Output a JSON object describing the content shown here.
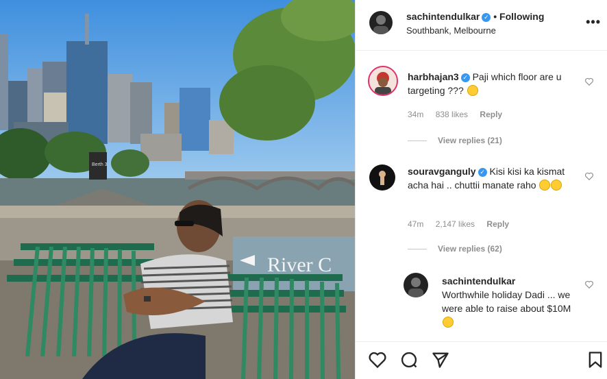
{
  "post": {
    "author": "sachintendulkar",
    "follow_status": "• Following",
    "location": "Southbank, Melbourne",
    "photo_sign_text": "River C",
    "photo_small_sign": "Berth 3"
  },
  "comments": [
    {
      "user": "harbhajan3",
      "verified": true,
      "text": "Paji which floor are u targeting ???",
      "time": "34m",
      "likes": "838 likes",
      "reply_label": "Reply",
      "view_replies": "View replies (21)"
    },
    {
      "user": "souravganguly",
      "verified": true,
      "text": "Kisi kisi ka kismat acha hai .. chuttii manate raho",
      "time": "47m",
      "likes": "2,147 likes",
      "reply_label": "Reply",
      "view_replies": "View replies (62)"
    }
  ],
  "reply": {
    "user": "sachintendulkar",
    "text": "Worthwhile holiday Dadi ... we were able to raise about $10M"
  },
  "icons": {
    "verified": "verified-badge-icon",
    "like": "heart-icon",
    "comment": "comment-icon",
    "share": "paper-plane-icon",
    "save": "bookmark-icon",
    "more": "more-options-icon"
  },
  "colors": {
    "verified": "#3897f0",
    "muted": "#8e8e8e",
    "text": "#262626",
    "bench": "#1f6b4e",
    "sky": "#5aa6e6"
  }
}
